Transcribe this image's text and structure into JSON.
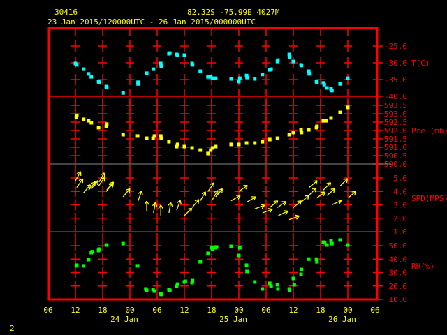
{
  "header": {
    "station": "30416",
    "location": "82.32S  -75.99E  4027M",
    "time_range": "23 Jan 2015/120000UTC - 26 Jan 2015/000000UTC"
  },
  "page_number": "2",
  "colors": {
    "frame": "#ff0000",
    "text": "#ffff00",
    "temp": "#00ffff",
    "pres": "#ffff00",
    "wind": "#ffff00",
    "rh": "#00ff00",
    "axis_label": "#ff0000"
  },
  "chart_data": {
    "type": "scatter",
    "title": "30416 meteogram",
    "x_unit": "hours since 23 Jan 12 UTC",
    "xlim": [
      -6,
      66
    ],
    "x_ticks": [
      {
        "h": -6,
        "label": "06"
      },
      {
        "h": 0,
        "label": "12"
      },
      {
        "h": 6,
        "label": "18"
      },
      {
        "h": 12,
        "label": "00"
      },
      {
        "h": 18,
        "label": "06"
      },
      {
        "h": 24,
        "label": "12"
      },
      {
        "h": 30,
        "label": "18"
      },
      {
        "h": 36,
        "label": "00"
      },
      {
        "h": 42,
        "label": "06"
      },
      {
        "h": 48,
        "label": "12"
      },
      {
        "h": 54,
        "label": "18"
      },
      {
        "h": 60,
        "label": "00"
      },
      {
        "h": 66,
        "label": "06"
      }
    ],
    "date_labels": [
      {
        "h": 12,
        "label": "24 Jan"
      },
      {
        "h": 36,
        "label": "25 Jan"
      },
      {
        "h": 60,
        "label": "26 Jan"
      }
    ],
    "panels": [
      {
        "name": "temperature",
        "ylabel": "T(C)",
        "ylim": [
          -40,
          -19.6
        ],
        "ticks": [
          "-25.0",
          "-30.0",
          "-35.0",
          "-40.0"
        ],
        "label_at": -30,
        "series": [
          [
            0,
            -30.2
          ],
          [
            0.3,
            -30.6
          ],
          [
            1.8,
            -31.9
          ],
          [
            2.9,
            -33.3
          ],
          [
            3.5,
            -34.2
          ],
          [
            5.1,
            -35.6
          ],
          [
            5.2,
            -35.8
          ],
          [
            6.8,
            -37.1
          ],
          [
            6.9,
            -37.3
          ],
          [
            10.5,
            -39.0
          ],
          [
            13.8,
            -36.3
          ],
          [
            13.8,
            -35.8
          ],
          [
            15.7,
            -33.1
          ],
          [
            17.2,
            -31.9
          ],
          [
            18.8,
            -30.2
          ],
          [
            18.9,
            -31.0
          ],
          [
            20.6,
            -27.3
          ],
          [
            20.8,
            -27.1
          ],
          [
            22.3,
            -27.5
          ],
          [
            22.5,
            -27.7
          ],
          [
            24.0,
            -27.7
          ],
          [
            25.7,
            -30.2
          ],
          [
            25.8,
            -30.6
          ],
          [
            27.5,
            -32.5
          ],
          [
            29.2,
            -34.2
          ],
          [
            29.8,
            -34.2
          ],
          [
            30.2,
            -34.6
          ],
          [
            30.9,
            -34.6
          ],
          [
            34.3,
            -34.8
          ],
          [
            36.0,
            -35.6
          ],
          [
            36.2,
            -34.6
          ],
          [
            37.7,
            -33.8
          ],
          [
            37.8,
            -34.4
          ],
          [
            39.5,
            -34.8
          ],
          [
            41.2,
            -33.5
          ],
          [
            42.8,
            -32.1
          ],
          [
            43.1,
            -31.9
          ],
          [
            44.5,
            -29.6
          ],
          [
            44.6,
            -29.2
          ],
          [
            47.1,
            -27.5
          ],
          [
            47.2,
            -28.3
          ],
          [
            48.0,
            -29.6
          ],
          [
            49.7,
            -30.6
          ],
          [
            49.8,
            -30.8
          ],
          [
            51.4,
            -32.5
          ],
          [
            51.5,
            -33.3
          ],
          [
            53.1,
            -35.6
          ],
          [
            53.2,
            -35.8
          ],
          [
            54.6,
            -36.0
          ],
          [
            54.8,
            -36.5
          ],
          [
            55.4,
            -37.5
          ],
          [
            56.3,
            -37.7
          ],
          [
            56.5,
            -38.3
          ],
          [
            58.3,
            -36.3
          ],
          [
            60.0,
            -34.6
          ]
        ]
      },
      {
        "name": "pressure",
        "ylabel": "Pre (mb)",
        "ylim": [
          590.0,
          594.0
        ],
        "ticks": [
          "593.5",
          "593.0",
          "592.5",
          "592.0",
          "591.5",
          "591.0",
          "590.5",
          "590.0"
        ],
        "label_at": 592.0,
        "series": [
          [
            0.2,
            592.8
          ],
          [
            0.3,
            592.9
          ],
          [
            1.8,
            592.67
          ],
          [
            2.9,
            592.58
          ],
          [
            3.5,
            592.46
          ],
          [
            5.1,
            592.17
          ],
          [
            6.8,
            592.25
          ],
          [
            6.9,
            592.38
          ],
          [
            10.5,
            591.75
          ],
          [
            13.7,
            591.67
          ],
          [
            15.7,
            591.54
          ],
          [
            17.1,
            591.54
          ],
          [
            17.4,
            591.67
          ],
          [
            18.8,
            591.67
          ],
          [
            18.9,
            591.54
          ],
          [
            20.6,
            591.33
          ],
          [
            22.3,
            591.04
          ],
          [
            22.5,
            591.17
          ],
          [
            24.0,
            591.04
          ],
          [
            25.7,
            590.96
          ],
          [
            27.5,
            590.83
          ],
          [
            29.2,
            590.63
          ],
          [
            29.8,
            590.83
          ],
          [
            30.2,
            590.96
          ],
          [
            30.9,
            591.04
          ],
          [
            34.3,
            591.17
          ],
          [
            36.0,
            591.17
          ],
          [
            37.7,
            591.25
          ],
          [
            39.5,
            591.25
          ],
          [
            41.2,
            591.33
          ],
          [
            42.8,
            591.46
          ],
          [
            44.5,
            591.54
          ],
          [
            47.1,
            591.75
          ],
          [
            48.0,
            591.88
          ],
          [
            49.7,
            592.04
          ],
          [
            49.8,
            591.88
          ],
          [
            51.4,
            592.04
          ],
          [
            53.1,
            592.17
          ],
          [
            53.2,
            592.25
          ],
          [
            54.6,
            592.58
          ],
          [
            55.2,
            592.58
          ],
          [
            56.3,
            592.75
          ],
          [
            58.3,
            593.08
          ],
          [
            60.0,
            593.38
          ]
        ]
      },
      {
        "name": "wind_speed",
        "ylabel": "SPD(MPS)",
        "ylim": [
          1.0,
          6.0
        ],
        "ticks": [
          "5.0",
          "4.0",
          "3.0",
          "2.0",
          "1.0"
        ],
        "label_at": 3.5,
        "series_note": "[hour, speed m/s, arrow direction deg]",
        "series": [
          [
            0,
            4.8,
            30
          ],
          [
            0.3,
            4.3,
            35
          ],
          [
            1.8,
            3.9,
            40
          ],
          [
            2.9,
            4.1,
            40
          ],
          [
            3.5,
            4.2,
            40
          ],
          [
            5.1,
            4.4,
            35
          ],
          [
            5.2,
            4.7,
            30
          ],
          [
            6.8,
            4.0,
            40
          ],
          [
            6.9,
            4.1,
            40
          ],
          [
            10.5,
            3.6,
            40
          ],
          [
            13.8,
            3.3,
            20
          ],
          [
            15.7,
            2.5,
            0
          ],
          [
            17.2,
            2.4,
            10
          ],
          [
            18.8,
            2.2,
            0
          ],
          [
            20.6,
            2.4,
            10
          ],
          [
            22.3,
            2.6,
            20
          ],
          [
            24.0,
            2.2,
            45
          ],
          [
            25.7,
            2.8,
            40
          ],
          [
            27.5,
            3.3,
            30
          ],
          [
            29.2,
            4.0,
            35
          ],
          [
            30.2,
            3.4,
            30
          ],
          [
            30.9,
            3.6,
            40
          ],
          [
            34.3,
            3.3,
            60
          ],
          [
            36.0,
            4.0,
            55
          ],
          [
            37.7,
            3.2,
            60
          ],
          [
            39.5,
            2.7,
            70
          ],
          [
            41.2,
            2.4,
            70
          ],
          [
            42.8,
            2.8,
            50
          ],
          [
            44.5,
            2.8,
            55
          ],
          [
            44.7,
            2.2,
            65
          ],
          [
            47.1,
            1.9,
            70
          ],
          [
            48.0,
            2.8,
            50
          ],
          [
            49.7,
            3.2,
            50
          ],
          [
            51.4,
            3.7,
            45
          ],
          [
            51.5,
            4.3,
            50
          ],
          [
            53.1,
            3.5,
            55
          ],
          [
            54.6,
            4.1,
            45
          ],
          [
            55.4,
            3.7,
            50
          ],
          [
            56.5,
            3.0,
            65
          ],
          [
            58.3,
            4.4,
            45
          ],
          [
            60.0,
            3.5,
            50
          ]
        ]
      },
      {
        "name": "relative_humidity",
        "ylabel": "RH(%)",
        "ylim": [
          10,
          60
        ],
        "ticks": [
          "50.0",
          "40.0",
          "30.0",
          "20.0",
          "10.0"
        ],
        "label_at": 35,
        "series": [
          [
            0.2,
            35
          ],
          [
            0.3,
            35.5
          ],
          [
            1.8,
            35
          ],
          [
            2.9,
            39.6
          ],
          [
            3.5,
            44.8
          ],
          [
            3.7,
            45.5
          ],
          [
            5.1,
            46.4
          ],
          [
            5.2,
            47.4
          ],
          [
            6.8,
            50.5
          ],
          [
            6.9,
            50.5
          ],
          [
            10.5,
            51.5
          ],
          [
            13.7,
            35
          ],
          [
            15.5,
            17.8
          ],
          [
            15.7,
            16.8
          ],
          [
            17.1,
            17.3
          ],
          [
            17.4,
            16.2
          ],
          [
            18.8,
            14.2
          ],
          [
            18.9,
            13.7
          ],
          [
            20.6,
            17.3
          ],
          [
            20.8,
            16.8
          ],
          [
            22.3,
            19.9
          ],
          [
            22.5,
            21.4
          ],
          [
            24.0,
            23
          ],
          [
            24.2,
            23.5
          ],
          [
            25.7,
            22.5
          ],
          [
            25.8,
            24
          ],
          [
            27.5,
            38
          ],
          [
            29.2,
            44.3
          ],
          [
            30.0,
            48.4
          ],
          [
            30.2,
            47.4
          ],
          [
            30.8,
            48.4
          ],
          [
            31.1,
            49
          ],
          [
            34.3,
            49.5
          ],
          [
            36.0,
            42.7
          ],
          [
            36.2,
            48.4
          ],
          [
            37.7,
            35.5
          ],
          [
            37.8,
            30.8
          ],
          [
            39.5,
            23
          ],
          [
            41.2,
            17.8
          ],
          [
            42.8,
            22
          ],
          [
            43.1,
            19.9
          ],
          [
            44.5,
            20.9
          ],
          [
            44.6,
            17.8
          ],
          [
            47.1,
            17.8
          ],
          [
            47.2,
            16.8
          ],
          [
            48.0,
            25.6
          ],
          [
            48.2,
            20.9
          ],
          [
            49.7,
            28.7
          ],
          [
            49.8,
            32.3
          ],
          [
            51.4,
            40
          ],
          [
            53.1,
            40
          ],
          [
            53.2,
            38
          ],
          [
            54.6,
            52.6
          ],
          [
            54.9,
            52.1
          ],
          [
            55.4,
            50.5
          ],
          [
            56.3,
            53.6
          ],
          [
            56.5,
            51.5
          ],
          [
            58.3,
            54.2
          ],
          [
            60.0,
            50.5
          ]
        ]
      }
    ]
  }
}
